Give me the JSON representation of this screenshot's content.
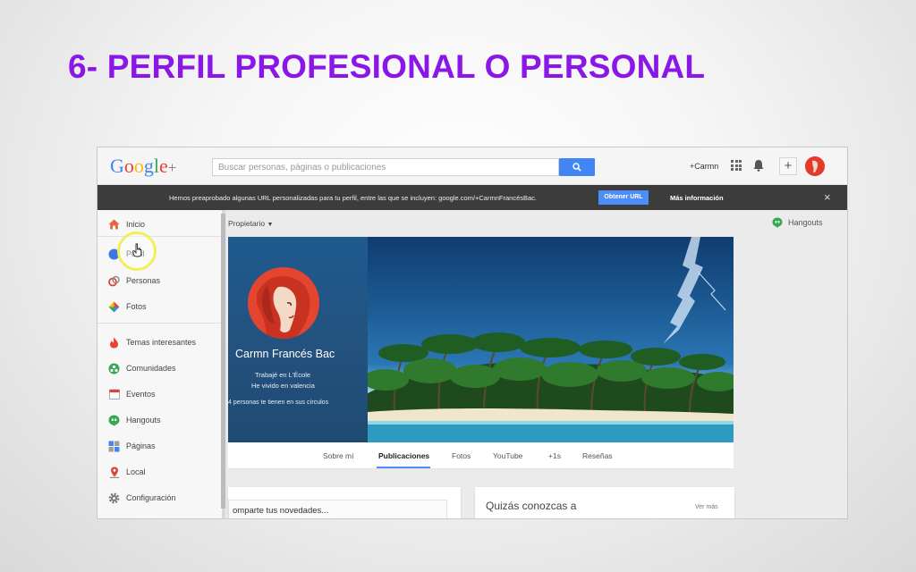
{
  "slide": {
    "title": "6- PERFIL PROFESIONAL O PERSONAL"
  },
  "gplus": {
    "logo": "Google+",
    "search_placeholder": "Buscar personas, páginas o publicaciones",
    "user_label": "+Carmn",
    "plus_label": "+"
  },
  "notice": {
    "text": "Hemos preaprobado algunas URL personalizadas para tu perfil, entre las que se incluyen: google.com/+CarmnFrancésBac.",
    "button": "Obtener URL",
    "more": "Más información",
    "close": "×"
  },
  "sidebar": {
    "items": [
      {
        "label": "Inicio",
        "icon": "home-icon"
      },
      {
        "label": "Perfil",
        "icon": "profile-icon"
      },
      {
        "label": "Personas",
        "icon": "people-icon"
      },
      {
        "label": "Fotos",
        "icon": "photos-icon"
      },
      {
        "label": "Temas interesantes",
        "icon": "trending-icon"
      },
      {
        "label": "Comunidades",
        "icon": "communities-icon"
      },
      {
        "label": "Eventos",
        "icon": "events-icon"
      },
      {
        "label": "Hangouts",
        "icon": "hangouts-icon"
      },
      {
        "label": "Páginas",
        "icon": "pages-icon"
      },
      {
        "label": "Local",
        "icon": "local-icon"
      },
      {
        "label": "Configuración",
        "icon": "settings-icon"
      }
    ]
  },
  "profile": {
    "owner_dropdown": "Propietario",
    "hangouts": "Hangouts",
    "name": "Carmn Francés Bac",
    "work": "Trabajé en L'École",
    "lived": "He vivido en valencia",
    "circles": "4 personas te tienen en sus círculos"
  },
  "tabs": [
    "Sobre mí",
    "Publicaciones",
    "Fotos",
    "YouTube",
    "+1s",
    "Reseñas"
  ],
  "feed": {
    "compose": "omparte tus novedades...",
    "suggest_title": "Quizás conozcas a",
    "see_more": "Ver más"
  },
  "colors": {
    "title": "#8a16e8",
    "google_blue": "#4285f4",
    "notice_bg": "#3c3c3c"
  }
}
